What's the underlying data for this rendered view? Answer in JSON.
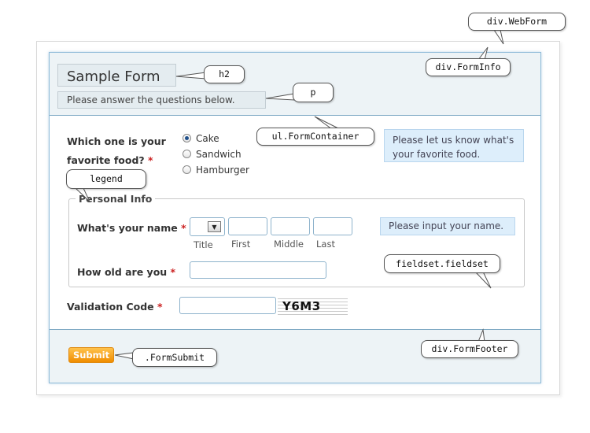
{
  "form": {
    "title": "Sample Form",
    "description": "Please answer the questions below.",
    "food_question": {
      "line1": "Which one is your",
      "line2": "favorite food?",
      "required_mark": "*"
    },
    "food_options": [
      {
        "label": "Cake",
        "selected": true
      },
      {
        "label": "Sandwich",
        "selected": false
      },
      {
        "label": "Hamburger",
        "selected": false
      }
    ],
    "food_tip": "Please let us know what's your favorite food.",
    "personal_info": {
      "legend": "Personal Info",
      "name_label": "What's your name",
      "required_mark": "*",
      "name_parts": [
        "Title",
        "First",
        "Middle",
        "Last"
      ],
      "name_tip": "Please input your name.",
      "age_label": "How old are you",
      "age_required_mark": "*"
    },
    "validation": {
      "label": "Validation Code",
      "required_mark": "*",
      "captcha": "Y6M3"
    },
    "submit_label": "Submit"
  },
  "callouts": {
    "webform": "div.WebForm",
    "forminfo": "div.FormInfo",
    "h2": "h2",
    "p": "p",
    "container": "ul.FormContainer",
    "legend": "legend",
    "fieldset": "fieldset.fieldset",
    "footer": "div.FormFooter",
    "submit": ".FormSubmit"
  },
  "colors": {
    "section_bg": "#edf3f6",
    "border_blue": "#7da8c3",
    "tip_bg": "#ddeefb",
    "required": "#cc2222",
    "submit": "#f5a11c"
  }
}
